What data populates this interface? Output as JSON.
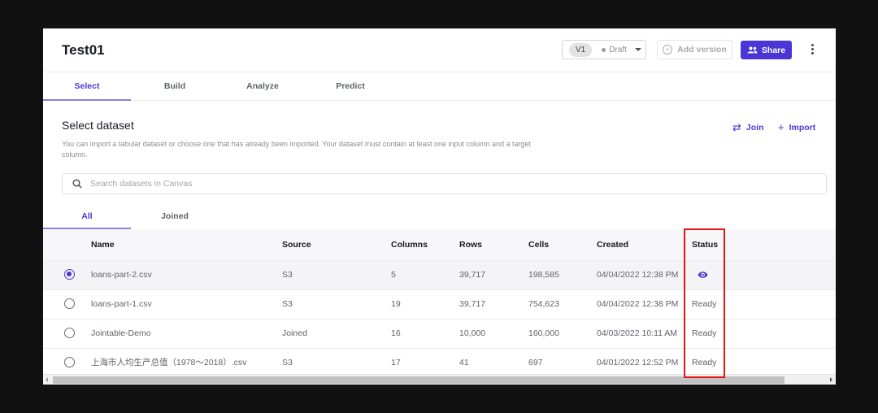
{
  "header": {
    "title": "Test01",
    "version_badge": "V1",
    "version_status": "Draft",
    "add_version_label": "Add version",
    "share_label": "Share"
  },
  "tabs": [
    {
      "label": "Select",
      "active": true
    },
    {
      "label": "Build",
      "active": false
    },
    {
      "label": "Analyze",
      "active": false
    },
    {
      "label": "Predict",
      "active": false
    }
  ],
  "section": {
    "title": "Select dataset",
    "description": "You can import a tabular dataset or choose one that has already been imported. Your dataset must contain at least one input column and a target column.",
    "join_label": "Join",
    "import_label": "Import"
  },
  "search": {
    "placeholder": "Search datasets in Canvas",
    "value": ""
  },
  "subtabs": [
    {
      "label": "All",
      "active": true
    },
    {
      "label": "Joined",
      "active": false
    }
  ],
  "table": {
    "columns": [
      "Name",
      "Source",
      "Columns",
      "Rows",
      "Cells",
      "Created",
      "Status"
    ],
    "rows": [
      {
        "selected": true,
        "name": "loans-part-2.csv",
        "source": "S3",
        "columns": "5",
        "rows": "39,717",
        "cells": "198,585",
        "created": "04/04/2022 12:38 PM",
        "status": "",
        "status_icon": "eye-icon"
      },
      {
        "selected": false,
        "name": "loans-part-1.csv",
        "source": "S3",
        "columns": "19",
        "rows": "39,717",
        "cells": "754,623",
        "created": "04/04/2022 12:38 PM",
        "status": "Ready"
      },
      {
        "selected": false,
        "name": "Jointable-Demo",
        "source": "Joined",
        "columns": "16",
        "rows": "10,000",
        "cells": "160,000",
        "created": "04/03/2022 10:11 AM",
        "status": "Ready"
      },
      {
        "selected": false,
        "name": "上海市人均生产总值（1978～2018）.csv",
        "source": "S3",
        "columns": "17",
        "rows": "41",
        "cells": "697",
        "created": "04/01/2022 12:52 PM",
        "status": "Ready"
      }
    ]
  },
  "colors": {
    "accent": "#4b35d6",
    "highlight": "#e01515"
  }
}
